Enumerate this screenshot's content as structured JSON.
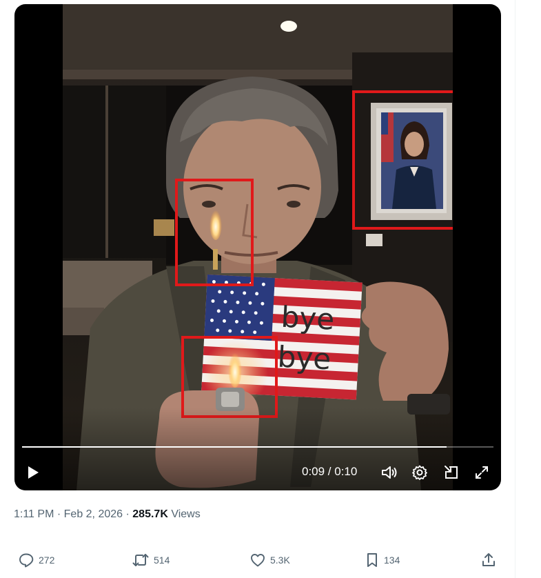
{
  "video": {
    "flag_text": [
      "bye",
      "bye"
    ],
    "time": "0:09 / 0:10",
    "progress_fraction": 0.9,
    "controls": {
      "play": "play-icon",
      "volume": "volume-icon",
      "settings": "gear-icon",
      "pip": "picture-in-picture-icon",
      "fullscreen": "fullscreen-icon"
    },
    "annotation_color": "#e0191a"
  },
  "tweet": {
    "time": "1:11 PM",
    "date": "Feb 2, 2026",
    "separator": "·",
    "views_count": "285.7K",
    "views_label": "Views"
  },
  "actions": {
    "reply_count": "272",
    "repost_count": "514",
    "like_count": "5.3K",
    "bookmark_count": "134"
  },
  "colors": {
    "muted_text": "#536471",
    "primary_text": "#0f1419"
  }
}
